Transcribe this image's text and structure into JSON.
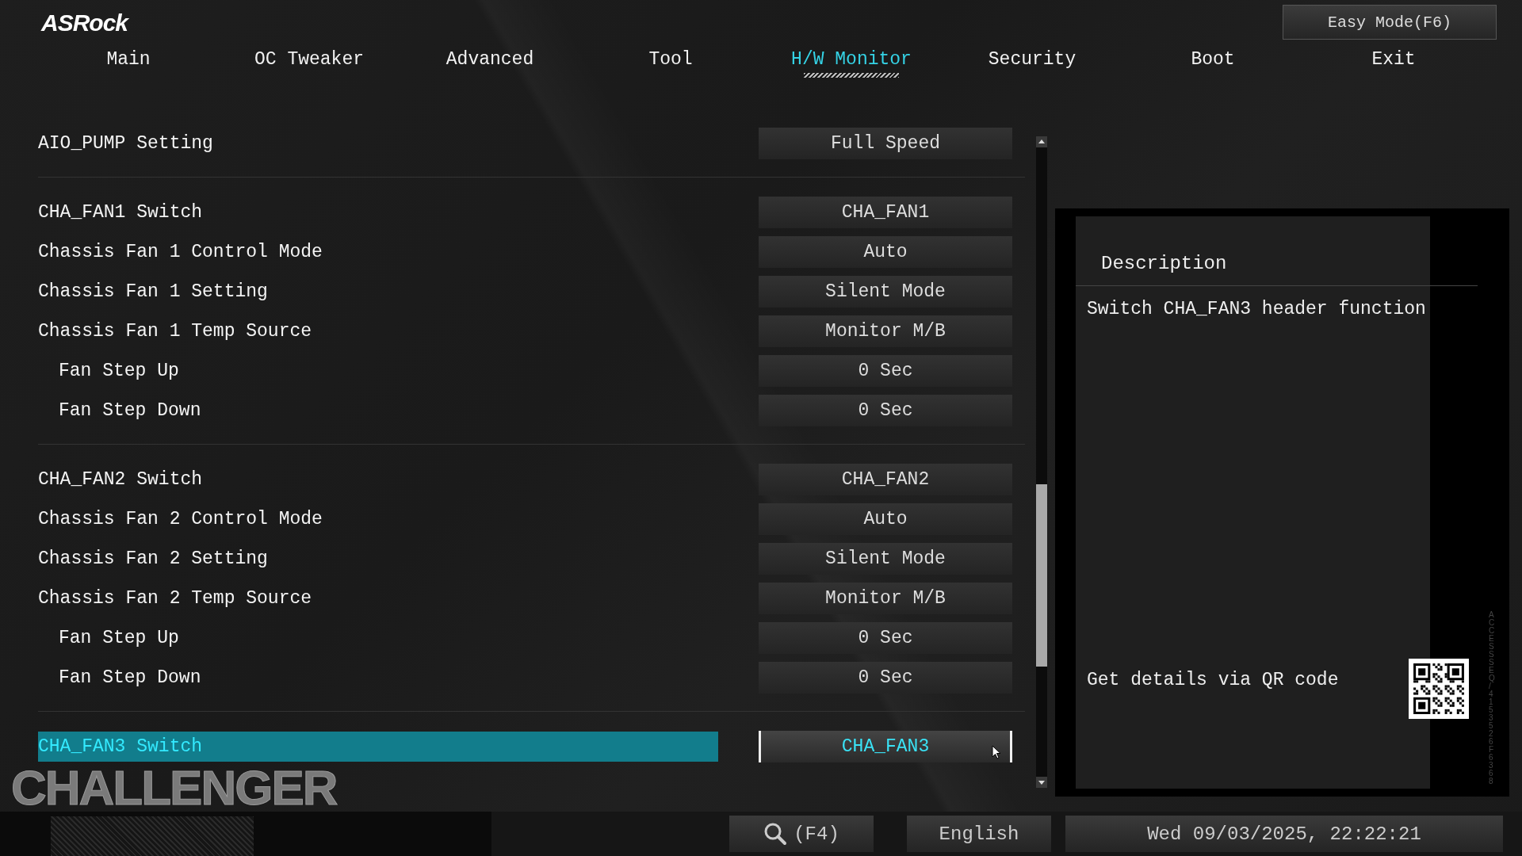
{
  "brand": "ASRock",
  "easy_mode_button": "Easy Mode(F6)",
  "tabs": [
    {
      "label": "Main",
      "selected": false
    },
    {
      "label": "OC Tweaker",
      "selected": false
    },
    {
      "label": "Advanced",
      "selected": false
    },
    {
      "label": "Tool",
      "selected": false
    },
    {
      "label": "H/W Monitor",
      "selected": true
    },
    {
      "label": "Security",
      "selected": false
    },
    {
      "label": "Boot",
      "selected": false
    },
    {
      "label": "Exit",
      "selected": false
    }
  ],
  "setting_groups": [
    {
      "items": [
        {
          "label": "AIO_PUMP Setting",
          "value": "Full Speed",
          "selected": false
        }
      ]
    },
    {
      "items": [
        {
          "label": "CHA_FAN1 Switch",
          "value": "CHA_FAN1",
          "selected": false
        },
        {
          "label": "Chassis Fan 1 Control Mode",
          "value": "Auto",
          "selected": false
        },
        {
          "label": "Chassis Fan 1 Setting",
          "value": "Silent Mode",
          "selected": false
        },
        {
          "label": "Chassis Fan 1 Temp Source",
          "value": "Monitor M/B",
          "selected": false,
          "children": [
            {
              "label": "Fan Step Up",
              "value": "0 Sec",
              "selected": false
            },
            {
              "label": "Fan Step Down",
              "value": "0 Sec",
              "selected": false
            }
          ]
        }
      ]
    },
    {
      "items": [
        {
          "label": "CHA_FAN2 Switch",
          "value": "CHA_FAN2",
          "selected": false
        },
        {
          "label": "Chassis Fan 2 Control Mode",
          "value": "Auto",
          "selected": false
        },
        {
          "label": "Chassis Fan 2 Setting",
          "value": "Silent Mode",
          "selected": false
        },
        {
          "label": "Chassis Fan 2 Temp Source",
          "value": "Monitor M/B",
          "selected": false,
          "children": [
            {
              "label": "Fan Step Up",
              "value": "0 Sec",
              "selected": false
            },
            {
              "label": "Fan Step Down",
              "value": "0 Sec",
              "selected": false
            }
          ]
        }
      ]
    },
    {
      "items": [
        {
          "label": "CHA_FAN3 Switch",
          "value": "CHA_FAN3",
          "selected": true
        }
      ]
    }
  ],
  "description": {
    "title": "Description",
    "text": "Switch CHA_FAN3 header function",
    "qr_label": "Get details via QR code",
    "side_label": "ACCESS SEQ",
    "side_code": "/ 4153526F6368"
  },
  "logo_text": "CHALLENGER",
  "footer": {
    "search_key": "(F4)",
    "language": "English",
    "datetime": "Wed 09/03/2025, 22:22:21"
  }
}
